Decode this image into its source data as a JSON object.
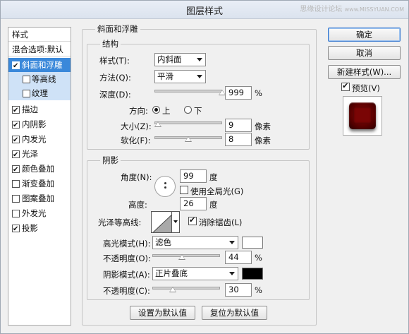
{
  "window": {
    "title": "图层样式",
    "watermark_cn": "思缘设计论坛",
    "watermark_en": "www.MISSYUAN.COM"
  },
  "style_list": {
    "header": "样式",
    "blend_options": "混合选项:默认",
    "items": [
      {
        "label": "斜面和浮雕",
        "checked": true,
        "selected": true
      },
      {
        "label": "等高线",
        "checked": false,
        "sub": true
      },
      {
        "label": "纹理",
        "checked": false,
        "sub": true
      },
      {
        "label": "描边",
        "checked": true
      },
      {
        "label": "内阴影",
        "checked": true
      },
      {
        "label": "内发光",
        "checked": true
      },
      {
        "label": "光泽",
        "checked": true
      },
      {
        "label": "颜色叠加",
        "checked": true
      },
      {
        "label": "渐变叠加",
        "checked": false
      },
      {
        "label": "图案叠加",
        "checked": false
      },
      {
        "label": "外发光",
        "checked": false
      },
      {
        "label": "投影",
        "checked": true
      }
    ]
  },
  "bevel": {
    "section_title": "斜面和浮雕",
    "structure": {
      "title": "结构",
      "style_label": "样式(T):",
      "style_value": "内斜面",
      "technique_label": "方法(Q):",
      "technique_value": "平滑",
      "depth_label": "深度(D):",
      "depth_value": "999",
      "depth_unit": "%",
      "depth_level": 1.0,
      "direction_label": "方向:",
      "direction_up": "上",
      "direction_down": "下",
      "direction_selected": "up",
      "size_label": "大小(Z):",
      "size_value": "9",
      "size_unit": "像素",
      "size_level": 0.05,
      "soften_label": "软化(F):",
      "soften_value": "8",
      "soften_unit": "像素",
      "soften_level": 0.5
    },
    "shading": {
      "title": "阴影",
      "angle_label": "角度(N):",
      "angle_value": "99",
      "angle_unit": "度",
      "global_light_label": "使用全局光(G)",
      "global_light_checked": false,
      "altitude_label": "高度:",
      "altitude_value": "26",
      "altitude_unit": "度",
      "gloss_contour_label": "光泽等高线:",
      "antialiased_label": "消除锯齿(L)",
      "antialiased_checked": true,
      "highlight_mode_label": "高光模式(H):",
      "highlight_mode_value": "滤色",
      "highlight_color": "#ffffff",
      "highlight_opacity_label": "不透明度(O):",
      "highlight_opacity_value": "44",
      "highlight_opacity_unit": "%",
      "highlight_opacity_level": 0.44,
      "shadow_mode_label": "阴影模式(A):",
      "shadow_mode_value": "正片叠底",
      "shadow_color": "#000000",
      "shadow_opacity_label": "不透明度(C):",
      "shadow_opacity_value": "30",
      "shadow_opacity_unit": "%",
      "shadow_opacity_level": 0.3
    },
    "make_default": "设置为默认值",
    "reset_default": "复位为默认值"
  },
  "actions": {
    "ok": "确定",
    "cancel": "取消",
    "new_style": "新建样式(W)...",
    "preview_label": "预览(V)",
    "preview_checked": true
  }
}
